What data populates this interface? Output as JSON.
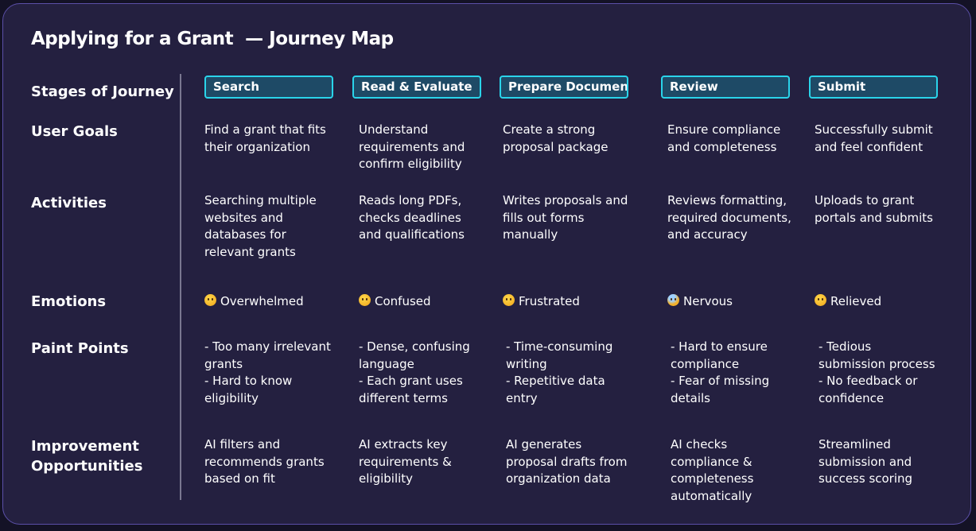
{
  "title": "Applying for a Grant  — Journey Map",
  "row_labels": {
    "stages": "Stages of Journey",
    "goals": "User Goals",
    "activities": "Activities",
    "emotions": "Emotions",
    "pain_points": "Paint Points",
    "improvement_1": "Improvement",
    "improvement_2": "Opportunities"
  },
  "stages": [
    "Search",
    "Read & Evaluate",
    "Prepare Documents",
    "Review",
    "Submit"
  ],
  "goals": [
    [
      "Find a grant that fits",
      "their organization"
    ],
    [
      "Understand",
      "requirements and",
      "confirm eligibility"
    ],
    [
      "Create a strong",
      "proposal package"
    ],
    [
      "Ensure compliance",
      "and completeness"
    ],
    [
      "Successfully submit",
      "and feel confident"
    ]
  ],
  "activities": [
    [
      "Searching multiple",
      "websites and",
      "databases for",
      "relevant grants"
    ],
    [
      "Reads long PDFs,",
      "checks deadlines",
      "and qualifications"
    ],
    [
      "Writes proposals and",
      "fills out forms",
      "manually"
    ],
    [
      "Reviews formatting,",
      "required documents,",
      "and accuracy"
    ],
    [
      "Uploads to grant",
      "portals and submits"
    ]
  ],
  "emotions": [
    {
      "icon": "weary-face-icon",
      "label": "Overwhelmed"
    },
    {
      "icon": "confused-face-icon",
      "label": "Confused"
    },
    {
      "icon": "frustrated-face-icon",
      "label": "Frustrated"
    },
    {
      "icon": "anxious-face-icon",
      "label": "Nervous"
    },
    {
      "icon": "relieved-face-icon",
      "label": "Relieved"
    }
  ],
  "pain_points": [
    [
      "- Too many irrelevant",
      "grants",
      "- Hard to know",
      "eligibility"
    ],
    [
      "- Dense, confusing",
      "language",
      "- Each grant uses",
      "different terms"
    ],
    [
      "- Time-consuming",
      "writing",
      "- Repetitive data",
      "entry"
    ],
    [
      "- Hard to ensure",
      "compliance",
      "- Fear of missing",
      "details"
    ],
    [
      "- Tedious",
      "submission process",
      "- No feedback or",
      "confidence"
    ]
  ],
  "improvements": [
    [
      "AI filters and",
      "recommends grants",
      "based on fit"
    ],
    [
      "AI extracts key",
      "requirements &",
      "eligibility"
    ],
    [
      "AI generates",
      "proposal drafts from",
      "organization data"
    ],
    [
      "AI checks",
      "compliance &",
      "completeness",
      "automatically"
    ],
    [
      "Streamlined",
      "submission and",
      "success scoring"
    ]
  ],
  "colors": {
    "background": "#141226",
    "card": "#242040",
    "card_border": "#5b4fa8",
    "stage_fill": "#1e4a66",
    "stage_border": "#2ad4ea",
    "divider": "#7a7890"
  }
}
